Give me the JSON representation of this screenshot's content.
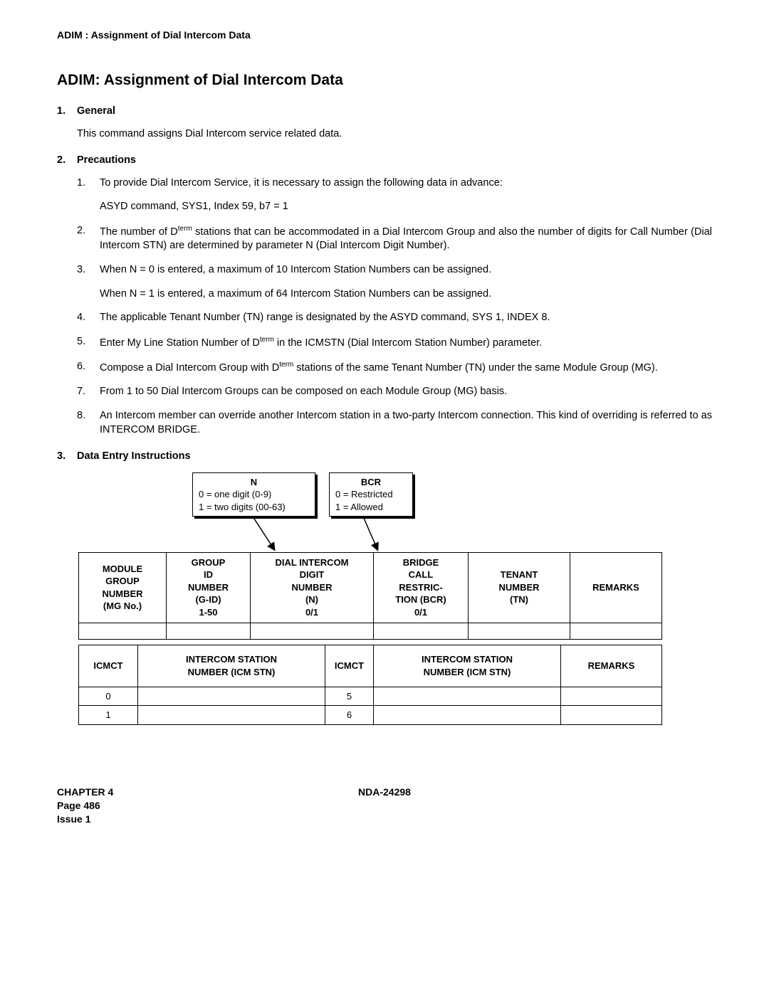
{
  "running_header": "ADIM : Assignment of Dial Intercom Data",
  "title": "ADIM: Assignment of Dial Intercom Data",
  "sections": {
    "s1": {
      "num": "1.",
      "title": "General"
    },
    "s2": {
      "num": "2.",
      "title": "Precautions"
    },
    "s3": {
      "num": "3.",
      "title": "Data Entry Instructions"
    }
  },
  "general_text": "This command assigns Dial Intercom service related data.",
  "precautions": {
    "p1": {
      "num": "1.",
      "text": "To provide Dial Intercom Service, it is necessary to assign the following data in advance:"
    },
    "p1_sub": "ASYD command, SYS1, Index 59, b7 = 1",
    "p2": {
      "num": "2.",
      "text_a": "The number of D",
      "sup_a": "term",
      "text_b": " stations that can be accommodated in a Dial Intercom Group and also the number of digits for Call Number (Dial Intercom STN) are determined by parameter N (Dial Intercom Digit Number)."
    },
    "p3": {
      "num": "3.",
      "text": "When N = 0 is entered, a maximum of 10 Intercom Station Numbers can be assigned."
    },
    "p3_sub": "When N = 1 is entered, a maximum of 64 Intercom Station Numbers can be assigned.",
    "p4": {
      "num": "4.",
      "text": "The applicable Tenant Number (TN) range is designated by the ASYD command, SYS 1, INDEX 8."
    },
    "p5": {
      "num": "5.",
      "text_a": "Enter My Line  Station Number of D",
      "sup_a": "term",
      "text_b": " in the ICMSTN (Dial Intercom Station Number) parameter."
    },
    "p6": {
      "num": "6.",
      "text_a": "Compose a Dial Intercom Group with D",
      "sup_a": "term",
      "text_b": " stations of the same Tenant Number (TN) under the same Module Group (MG)."
    },
    "p7": {
      "num": "7.",
      "text": "From 1 to 50 Dial Intercom Groups can be composed on each Module Group (MG) basis."
    },
    "p8": {
      "num": "8.",
      "text": "An Intercom member can override another Intercom station in a two-party Intercom connection. This kind of overriding is referred to as INTERCOM BRIDGE."
    }
  },
  "callouts": {
    "n": {
      "cap": "N",
      "l1": "0 = one digit (0-9)",
      "l2": "1 = two digits (00-63)"
    },
    "bcr": {
      "cap": "BCR",
      "l1": "0 = Restricted",
      "l2": "1 = Allowed"
    }
  },
  "main_headers": {
    "c1": "MODULE GROUP NUMBER (MG No.)",
    "c2": "GROUP ID NUMBER (G-ID) 1-50",
    "c3": "DIAL INTERCOM DIGIT NUMBER (N) 0/1",
    "c4": "BRIDGE CALL RESTRIC-TION (BCR) 0/1",
    "c5": "TENANT NUMBER (TN)",
    "c6": "REMARKS"
  },
  "sub_headers": {
    "h1": "ICMCT",
    "h2": "INTERCOM STATION NUMBER (ICM STN)",
    "h3": "ICMCT",
    "h4": "INTERCOM STATION NUMBER (ICM STN)",
    "h5": "REMARKS"
  },
  "sub_rows": {
    "r1": {
      "a": "0",
      "b": "",
      "c": "5",
      "d": "",
      "e": ""
    },
    "r2": {
      "a": "1",
      "b": "",
      "c": "6",
      "d": "",
      "e": ""
    }
  },
  "footer": {
    "chapter": "CHAPTER 4",
    "page": "Page 486",
    "issue": "Issue 1",
    "doc": "NDA-24298"
  }
}
